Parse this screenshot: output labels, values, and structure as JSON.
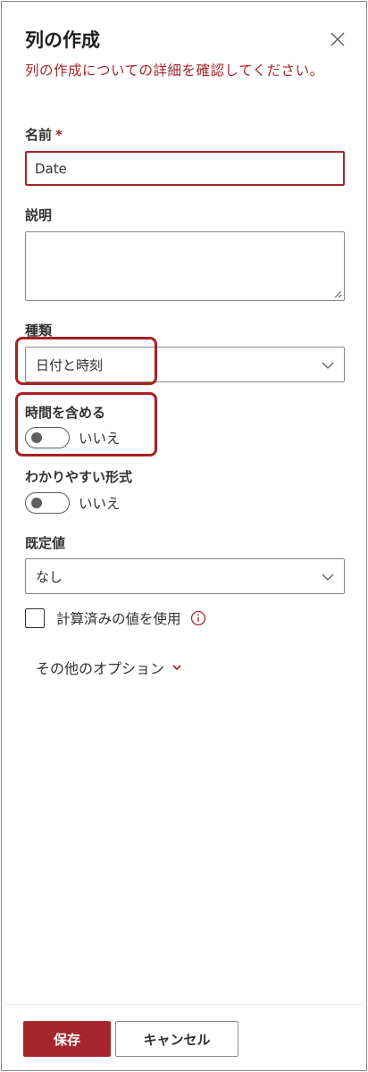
{
  "panel": {
    "title": "列の作成",
    "description": "列の作成についての詳細を確認してください。",
    "close_icon": "close-icon"
  },
  "fields": {
    "name": {
      "label": "名前",
      "required_mark": "*",
      "value": "Date"
    },
    "description": {
      "label": "説明",
      "value": ""
    },
    "type": {
      "label": "種類",
      "selected": "日付と時刻"
    },
    "include_time": {
      "label": "時間を含める",
      "state": "いいえ",
      "on": false
    },
    "friendly_format": {
      "label": "わかりやすい形式",
      "state": "いいえ",
      "on": false
    },
    "default_value": {
      "label": "既定値",
      "selected": "なし"
    },
    "use_calculated": {
      "label": "計算済みの値を使用",
      "checked": false,
      "info_icon": "info-icon"
    }
  },
  "more_options": {
    "label": "その他のオプション"
  },
  "footer": {
    "save_label": "保存",
    "cancel_label": "キャンセル"
  },
  "colors": {
    "accent": "#a4262c",
    "highlight": "#a82121",
    "text": "#323130",
    "border": "#8a8886"
  }
}
